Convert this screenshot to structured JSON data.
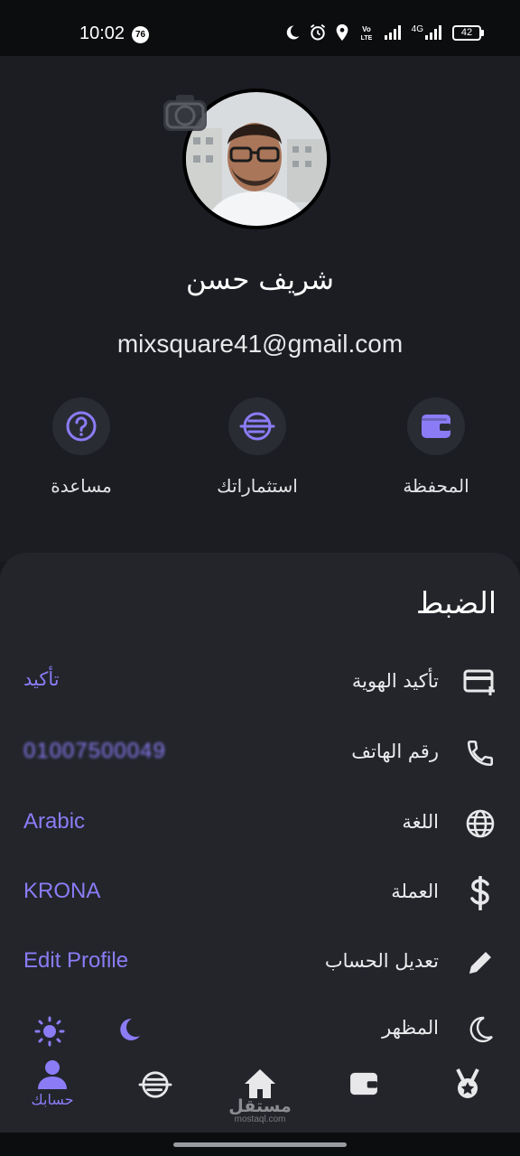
{
  "status_bar": {
    "time": "10:02",
    "notification_count": "76",
    "network_label": "4G",
    "battery": "42"
  },
  "profile": {
    "name": "شريف حسن",
    "email": "mixsquare41@gmail.com"
  },
  "quick_actions": [
    {
      "label": "مساعدة",
      "icon": "help-circle-icon"
    },
    {
      "label": "استثماراتك",
      "icon": "investment-coin-icon"
    },
    {
      "label": "المحفظة",
      "icon": "wallet-icon"
    }
  ],
  "settings": {
    "title": "الضبط",
    "rows": [
      {
        "label": "تأكيد الهوية",
        "value": "تأكيد",
        "icon": "id-card-add-icon"
      },
      {
        "label": "رقم الهاتف",
        "value": "01007500049",
        "icon": "phone-icon"
      },
      {
        "label": "اللغة",
        "value": "Arabic",
        "icon": "globe-icon"
      },
      {
        "label": "العملة",
        "value": "KRONA",
        "icon": "dollar-icon"
      },
      {
        "label": "تعديل الحساب",
        "value": "Edit Profile",
        "icon": "pencil-icon"
      },
      {
        "label": "المظهر",
        "value": "",
        "icon": "moon-icon"
      }
    ]
  },
  "bottom_nav": {
    "active_label": "حسابك",
    "items": [
      "profile-icon",
      "investment-coin-icon",
      "home-icon",
      "wallet-icon",
      "medal-icon"
    ]
  },
  "watermark": {
    "main": "مستقل",
    "sub": "mostaql.com"
  },
  "colors": {
    "accent": "#8b7cf6",
    "background": "#16181d",
    "card": "#23252b"
  }
}
